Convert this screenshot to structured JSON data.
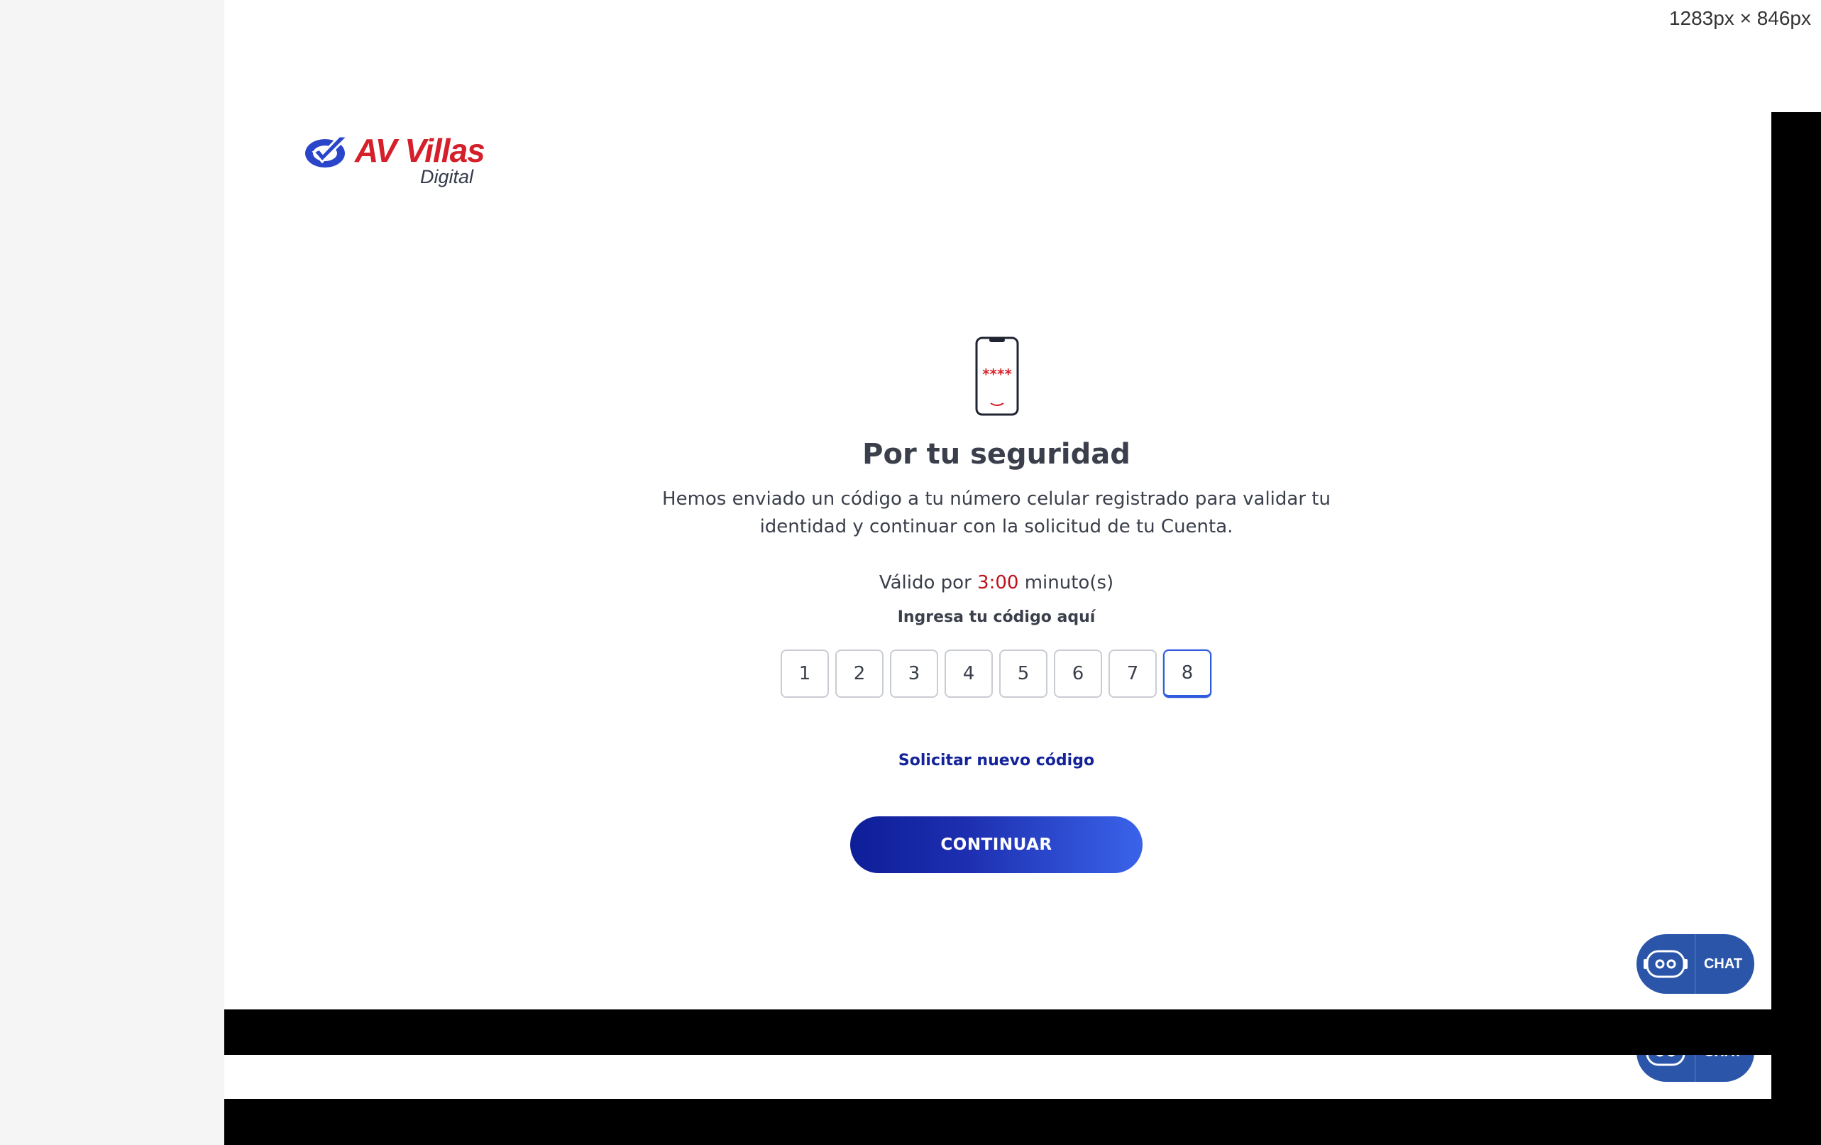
{
  "viewport_readout": "1283px × 846px",
  "brand": {
    "name": "AV Villas",
    "subtitle": "Digital",
    "primary_color": "#d51f2a",
    "accent_color": "#2f5bdc"
  },
  "security": {
    "icon": "phone-icon",
    "phone_screen_text": "****",
    "title": "Por tu seguridad",
    "description": "Hemos enviado un código a tu número celular registrado para validar tu identidad y continuar con la solicitud de tu Cuenta.",
    "validity_prefix": "Válido por",
    "validity_timer": "3:00",
    "validity_suffix": "minuto(s)",
    "code_label": "Ingresa tu código aquí",
    "code_digits": [
      "1",
      "2",
      "3",
      "4",
      "5",
      "6",
      "7",
      "8"
    ],
    "active_digit_index": 7,
    "new_code_link": "Solicitar nuevo código",
    "continue_button": "CONTINUAR"
  },
  "chat": {
    "label": "CHAT",
    "icon": "robot-icon",
    "color": "#2a55a8"
  }
}
